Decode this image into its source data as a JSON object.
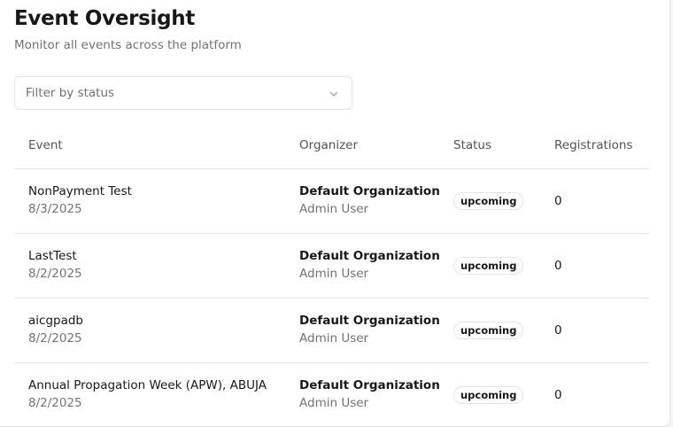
{
  "page": {
    "title": "Event Oversight",
    "subtitle": "Monitor all events across the platform"
  },
  "filter": {
    "placeholder": "Filter by status",
    "icon": "chevron-down-icon"
  },
  "table": {
    "columns": {
      "event": "Event",
      "organizer": "Organizer",
      "status": "Status",
      "registrations": "Registrations"
    },
    "rows": [
      {
        "event_name": "NonPayment Test",
        "event_date": "8/3/2025",
        "organization": "Default Organization",
        "organizer_user": "Admin User",
        "status": "upcoming",
        "registrations": "0"
      },
      {
        "event_name": "LastTest",
        "event_date": "8/2/2025",
        "organization": "Default Organization",
        "organizer_user": "Admin User",
        "status": "upcoming",
        "registrations": "0"
      },
      {
        "event_name": "aicgpadb",
        "event_date": "8/2/2025",
        "organization": "Default Organization",
        "organizer_user": "Admin User",
        "status": "upcoming",
        "registrations": "0"
      },
      {
        "event_name": "Annual Propagation Week (APW), ABUJA",
        "event_date": "8/2/2025",
        "organization": "Default Organization",
        "organizer_user": "Admin User",
        "status": "upcoming",
        "registrations": "0"
      }
    ]
  }
}
